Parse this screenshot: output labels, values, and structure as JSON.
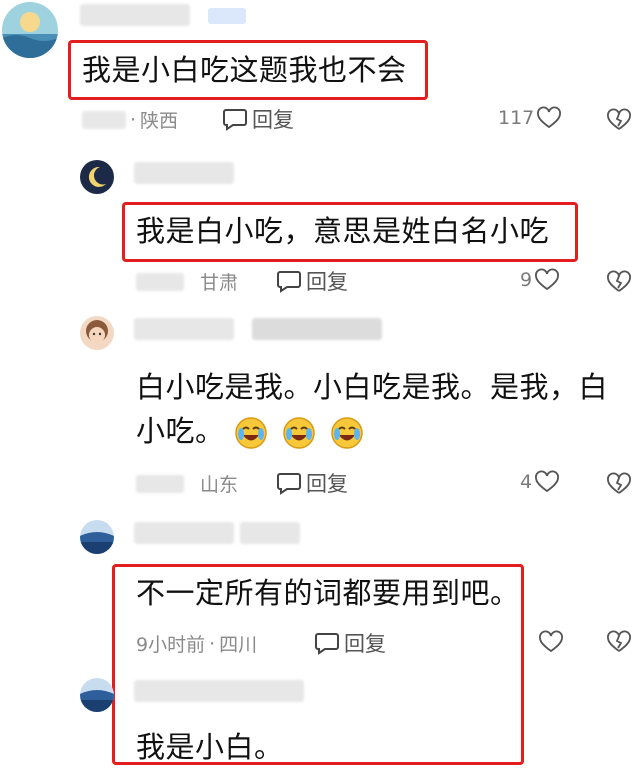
{
  "comments": [
    {
      "text": "我是小白吃这题我也不会",
      "location": "陕西",
      "reply_label": "回复",
      "likes": "117"
    },
    {
      "text": "我是白小吃，意思是姓白名小吃",
      "location": "甘肃",
      "reply_label": "回复",
      "likes": "9"
    },
    {
      "text_line1": "白小吃是我。小白吃是我。是我，白",
      "text_line2": "小吃。",
      "location": "山东",
      "reply_label": "回复",
      "likes": "4",
      "emoji": [
        "laughing-crying-emoji",
        "laughing-crying-emoji",
        "laughing-crying-emoji"
      ]
    },
    {
      "text": "不一定所有的词都要用到吧。",
      "time": "9小时前",
      "location": "四川",
      "reply_label": "回复"
    },
    {
      "text": "我是小白。"
    }
  ],
  "colors": {
    "highlight": "#e41e1e",
    "meta_gray": "#8a8a8a",
    "blue_badge": "#dbe7fb"
  }
}
